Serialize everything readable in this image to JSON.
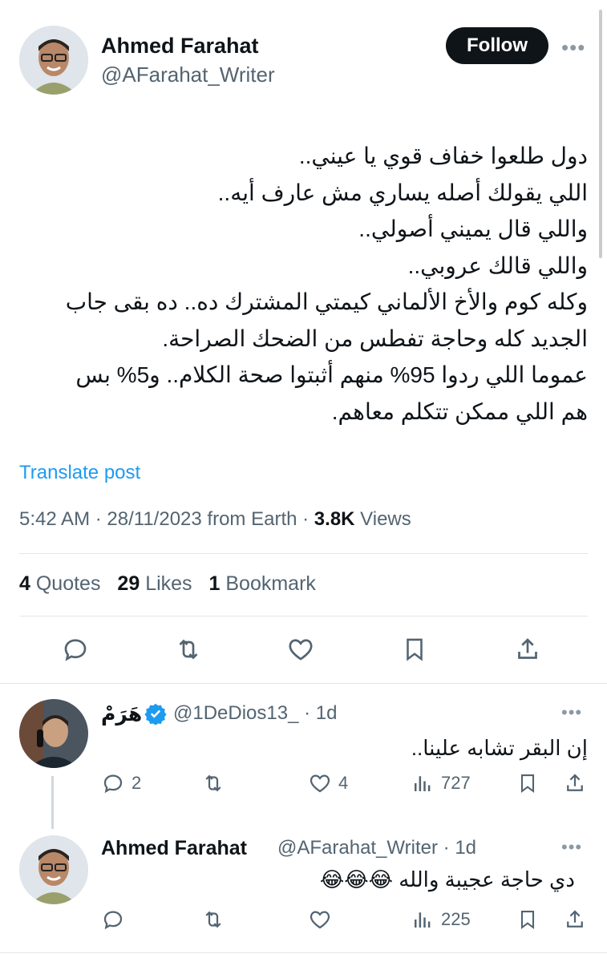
{
  "main_tweet": {
    "author_name": "Ahmed Farahat",
    "author_handle": "@AFarahat_Writer",
    "follow_label": "Follow",
    "text_lines": [
      "دول طلعوا خفاف قوي يا عيني..",
      "اللي يقولك أصله يساري مش عارف أيه..",
      "واللي قال يميني أصولي..",
      "واللي قالك عروبي..",
      "وكله كوم والأخ الألماني كيمتي المشترك ده.. ده بقى جاب",
      "الجديد كله وحاجة تفطس من الضحك الصراحة.",
      "عموما اللي ردوا 95% منهم أثبتوا صحة الكلام.. و5% بس",
      "هم اللي ممكن تتكلم معاهم."
    ],
    "translate_label": "Translate post",
    "time": "5:42 AM",
    "date": "28/11/2023",
    "source": "from Earth",
    "views_count": "3.8K",
    "views_label": "Views",
    "quotes_count": "4",
    "quotes_label": "Quotes",
    "likes_count": "29",
    "likes_label": "Likes",
    "bookmarks_count": "1",
    "bookmarks_label": "Bookmark"
  },
  "replies": [
    {
      "author_name": "هَرَمْ",
      "author_handle": "@1DeDios13_",
      "time": "· 1d",
      "verified": true,
      "text": "إن البقر تشابه علينا..",
      "reply_count": "2",
      "repost_count": "",
      "like_count": "4",
      "view_count": "727"
    },
    {
      "author_name": "Ahmed Farahat",
      "author_handle": "@AFarahat_Writer",
      "time": "· 1d",
      "verified": false,
      "text": "دي حاجة عجيبة والله 😂😂😂",
      "reply_count": "",
      "repost_count": "",
      "like_count": "",
      "view_count": "225"
    }
  ],
  "colors": {
    "text": "#0f1419",
    "secondary": "#536471",
    "link": "#1d9bf0",
    "verified": "#1d9bf0",
    "divider": "#e1e6ea"
  },
  "icons": {
    "reply": "reply-icon",
    "repost": "repost-icon",
    "like": "heart-icon",
    "bookmark": "bookmark-icon",
    "share": "share-icon",
    "views": "views-icon",
    "more": "more-dots-icon"
  }
}
